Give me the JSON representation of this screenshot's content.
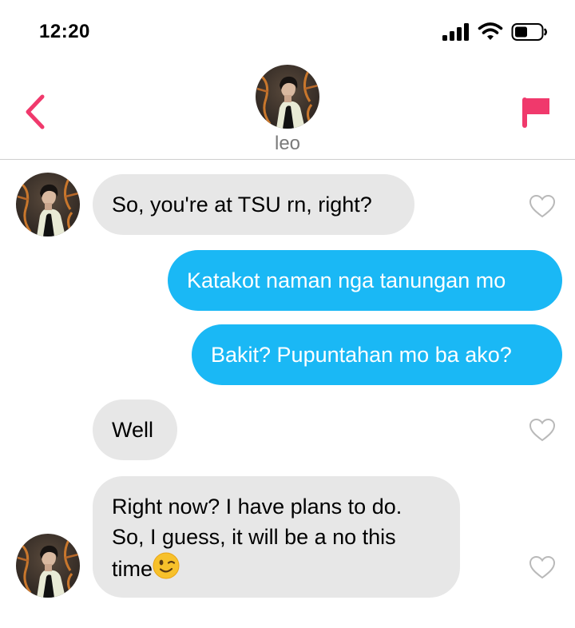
{
  "status_bar": {
    "time": "12:20"
  },
  "header": {
    "contact_name": "leo"
  },
  "messages": [
    {
      "direction": "in",
      "text": "So, you're at TSU rn, right?"
    },
    {
      "direction": "out",
      "text": "Katakot naman nga tanungan mo"
    },
    {
      "direction": "out",
      "text": "Bakit? Pupuntahan mo ba ako?"
    },
    {
      "direction": "in",
      "text": "Well"
    },
    {
      "direction": "in",
      "text": "Right now? I have plans to do.\nSo, I guess, it will be a no this time",
      "emoji": "winking-face"
    }
  ],
  "colors": {
    "accent_pink": "#f0396c",
    "outgoing_bubble": "#1ab8f5",
    "incoming_bubble": "#e7e7e7"
  },
  "icons": [
    "back-chevron-icon",
    "flag-icon",
    "heart-outline-icon",
    "signal-icon",
    "wifi-icon",
    "battery-icon"
  ]
}
